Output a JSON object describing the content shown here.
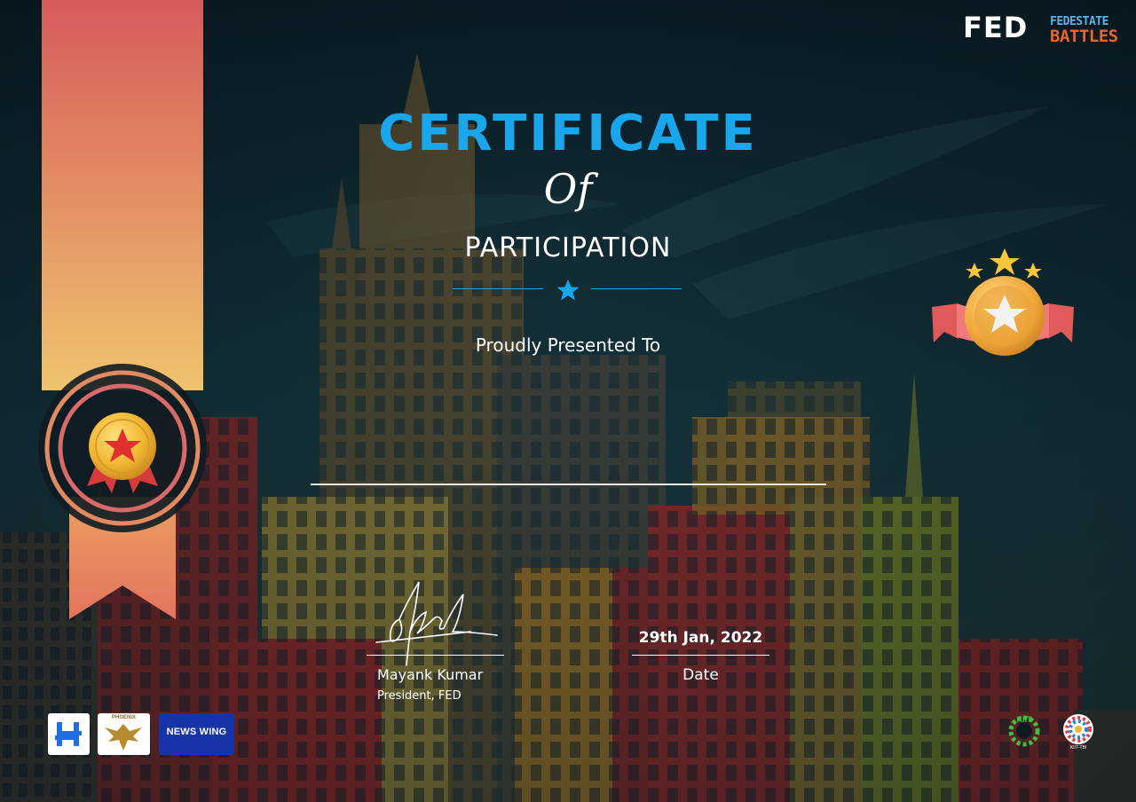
{
  "brand": {
    "fed_logo": "FED",
    "event_logo_line1": "FEDESTATE",
    "event_logo_line2": "BATTLES"
  },
  "certificate": {
    "title": "CERTIFICATE",
    "of": "Of",
    "subtitle": "PARTICIPATION",
    "presented_to": "Proudly Presented To",
    "recipient_name": ""
  },
  "signatory": {
    "name": "Mayank Kumar",
    "role": "President, FED"
  },
  "date": {
    "value": "29th Jan, 2022",
    "label": "Date"
  },
  "sponsors": {
    "phoenix": "PHOENIX",
    "news_wing": "NEWS WING",
    "kiit_tbi": "KIIT-TBI"
  },
  "colors": {
    "title_blue": "#19a6ea",
    "ribbon_top": "#d95b5b",
    "ribbon_bottom": "#f0c070",
    "medal_gold": "#f2b632"
  },
  "icons": [
    "ribbon-medal-icon",
    "star-medal-badge-icon",
    "divider-star-icon",
    "signature-image"
  ]
}
